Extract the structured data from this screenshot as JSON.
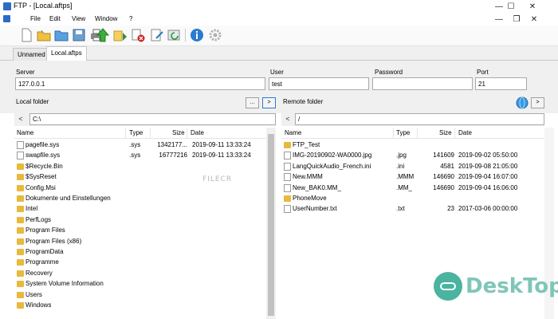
{
  "window": {
    "title": "FTP - [Local.aftps]"
  },
  "menu": [
    "File",
    "Edit",
    "View",
    "Window",
    "?"
  ],
  "toolbar": {
    "buttons": [
      "new-file-icon",
      "open-folder-icon",
      "open-icon",
      "save-icon",
      "print-icon",
      "upload-icon",
      "download-icon",
      "delete-icon",
      "rename-icon",
      "refresh-icon",
      "info-icon",
      "settings-icon"
    ]
  },
  "tabs": [
    "Unnamed",
    "Local.aftps"
  ],
  "connection": {
    "server_label": "Server",
    "server_value": "127.0.0.1",
    "user_label": "User",
    "user_value": "test",
    "password_label": "Password",
    "password_value": "",
    "port_label": "Port",
    "port_value": "21",
    "local_folder_label": "Local folder",
    "remote_folder_label": "Remote folder",
    "browse_label": "...",
    "go_label": ">"
  },
  "local": {
    "path": "C:\\",
    "columns": [
      "Name",
      "Type",
      "Size",
      "Date"
    ],
    "rows": [
      {
        "kind": "file",
        "name": "pagefile.sys",
        "type": ".sys",
        "size": "1342177...",
        "date": "2019-09-11 13:33:24"
      },
      {
        "kind": "file",
        "name": "swapfile.sys",
        "type": ".sys",
        "size": "16777216",
        "date": "2019-09-11 13:33:24"
      },
      {
        "kind": "folder",
        "name": "$Recycle.Bin",
        "type": "",
        "size": "",
        "date": ""
      },
      {
        "kind": "folder",
        "name": "$SysReset",
        "type": "",
        "size": "",
        "date": ""
      },
      {
        "kind": "folder",
        "name": "Config.Msi",
        "type": "",
        "size": "",
        "date": ""
      },
      {
        "kind": "folder",
        "name": "Dokumente und Einstellungen",
        "type": "",
        "size": "",
        "date": ""
      },
      {
        "kind": "folder",
        "name": "Intel",
        "type": "",
        "size": "",
        "date": ""
      },
      {
        "kind": "folder",
        "name": "PerfLogs",
        "type": "",
        "size": "",
        "date": ""
      },
      {
        "kind": "folder",
        "name": "Program Files",
        "type": "",
        "size": "",
        "date": ""
      },
      {
        "kind": "folder",
        "name": "Program Files (x86)",
        "type": "",
        "size": "",
        "date": ""
      },
      {
        "kind": "folder",
        "name": "ProgramData",
        "type": "",
        "size": "",
        "date": ""
      },
      {
        "kind": "folder",
        "name": "Programme",
        "type": "",
        "size": "",
        "date": ""
      },
      {
        "kind": "folder",
        "name": "Recovery",
        "type": "",
        "size": "",
        "date": ""
      },
      {
        "kind": "folder",
        "name": "System Volume Information",
        "type": "",
        "size": "",
        "date": ""
      },
      {
        "kind": "folder",
        "name": "Users",
        "type": "",
        "size": "",
        "date": ""
      },
      {
        "kind": "folder",
        "name": "Windows",
        "type": "",
        "size": "",
        "date": ""
      }
    ]
  },
  "remote": {
    "path": "/",
    "columns": [
      "Name",
      "Type",
      "Size",
      "Date"
    ],
    "rows": [
      {
        "kind": "folder",
        "name": "FTP_Test",
        "type": "",
        "size": "",
        "date": ""
      },
      {
        "kind": "file",
        "name": "IMG-20190902-WA0000.jpg",
        "type": ".jpg",
        "size": "141609",
        "date": "2019-09-02 05:50:00"
      },
      {
        "kind": "file",
        "name": "LangQuickAudio_French.ini",
        "type": ".ini",
        "size": "4581",
        "date": "2019-09-08 21:05:00"
      },
      {
        "kind": "file",
        "name": "New.MMM",
        "type": ".MMM",
        "size": "146690",
        "date": "2019-09-04 16:07:00"
      },
      {
        "kind": "file",
        "name": "New_BAK0.MM_",
        "type": ".MM_",
        "size": "146690",
        "date": "2019-09-04 16:06:00"
      },
      {
        "kind": "folder",
        "name": "PhoneMove",
        "type": "",
        "size": "",
        "date": ""
      },
      {
        "kind": "file",
        "name": "UserNumber.txt",
        "type": ".txt",
        "size": "23",
        "date": "2017-03-06 00:00:00"
      }
    ]
  },
  "watermarks": {
    "center": "FILECR",
    "brand": "DeskTop",
    "brand_accent": "#4ab4a0"
  }
}
